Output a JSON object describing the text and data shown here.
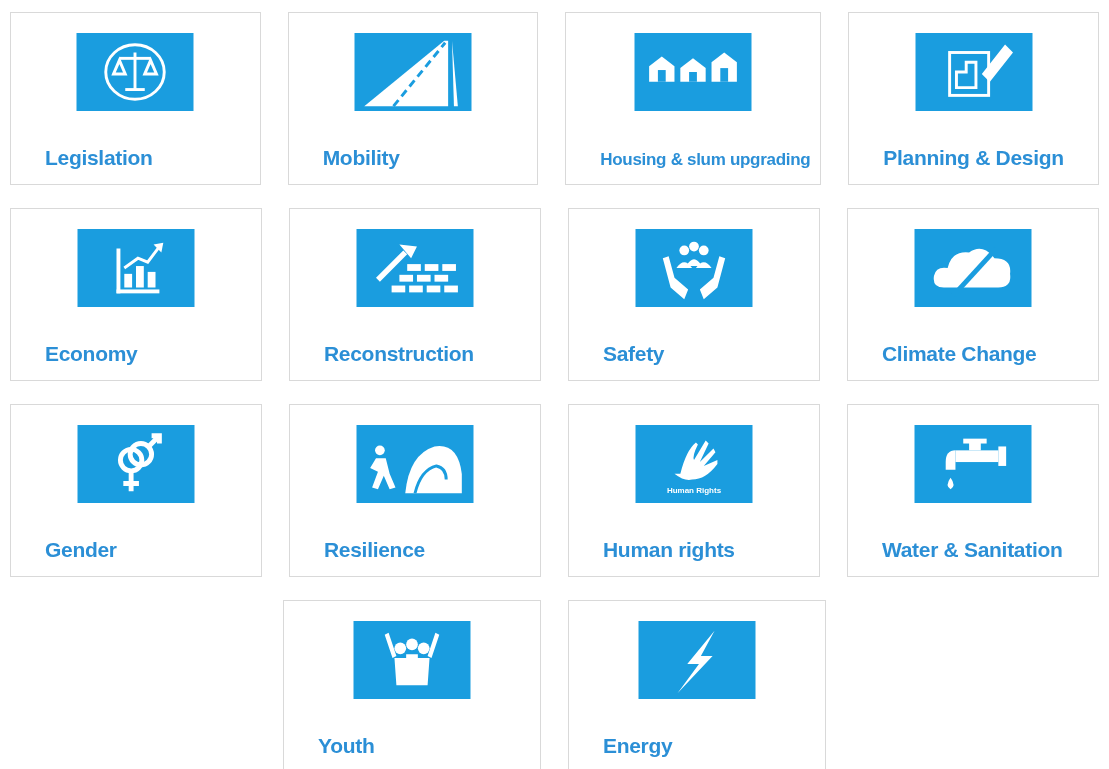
{
  "rows": [
    {
      "tiles": [
        {
          "label": "Legislation",
          "kind": "scales"
        },
        {
          "label": "Mobility",
          "kind": "road"
        },
        {
          "label": "Housing & slum upgrading",
          "kind": "houses"
        },
        {
          "label": "Planning & Design",
          "kind": "plan"
        }
      ]
    },
    {
      "tiles": [
        {
          "label": "Economy",
          "kind": "chart"
        },
        {
          "label": "Reconstruction",
          "kind": "bricks"
        },
        {
          "label": "Safety",
          "kind": "hands"
        },
        {
          "label": "Climate Change",
          "kind": "cloud"
        }
      ]
    },
    {
      "tiles": [
        {
          "label": "Gender",
          "kind": "gender"
        },
        {
          "label": "Resilience",
          "kind": "wave"
        },
        {
          "label": "Human rights",
          "kind": "hand",
          "icon_text": "Human Rights"
        },
        {
          "label": "Water & Sanitation",
          "kind": "tap"
        }
      ]
    },
    {
      "tiles": [
        {
          "label": "Youth",
          "kind": "people"
        },
        {
          "label": "Energy",
          "kind": "bolt"
        }
      ]
    }
  ]
}
